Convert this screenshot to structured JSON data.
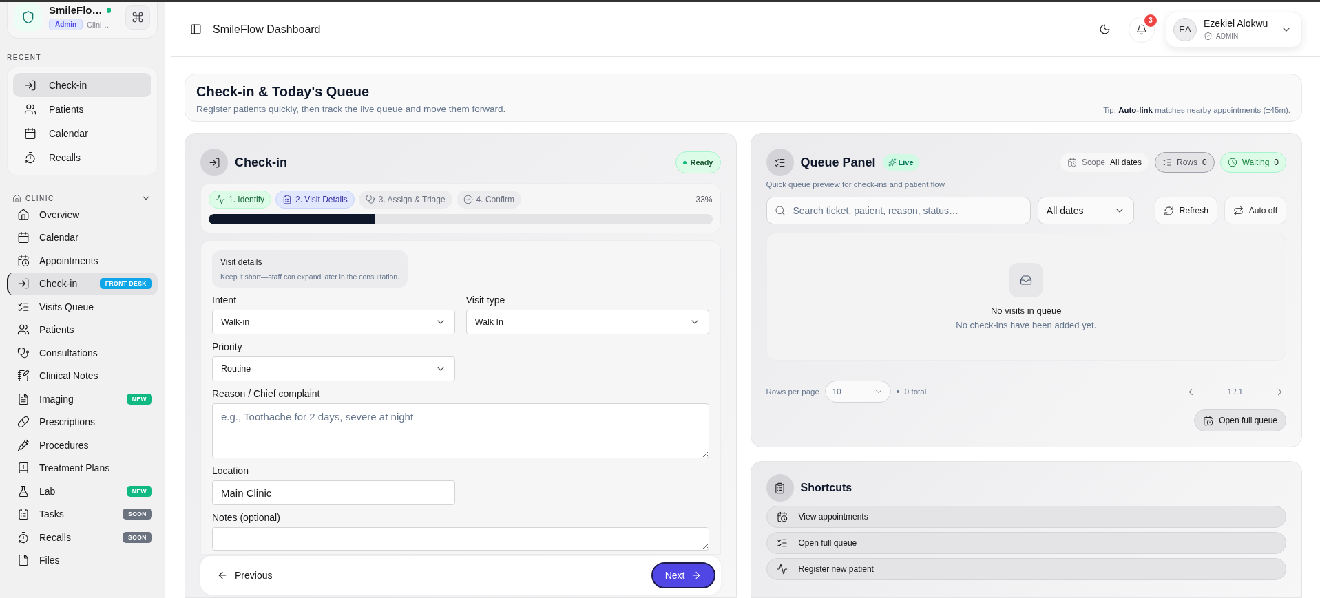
{
  "sidebar": {
    "brand": {
      "name": "SmileFlo…",
      "online": true,
      "role": "Admin",
      "subtitle": "Clini…"
    },
    "recent_title": "RECENT",
    "recent": [
      {
        "label": "Check-in",
        "selected": true
      },
      {
        "label": "Patients",
        "selected": false
      },
      {
        "label": "Calendar",
        "selected": false
      },
      {
        "label": "Recalls",
        "selected": false
      }
    ],
    "group": {
      "title": "CLINIC",
      "expanded": true
    },
    "items": [
      {
        "label": "Overview",
        "selected": false
      },
      {
        "label": "Calendar",
        "selected": false
      },
      {
        "label": "Appointments",
        "selected": false
      },
      {
        "label": "Check-in",
        "selected": true,
        "badge": {
          "text": "FRONT DESK",
          "color": "#0ea5e9"
        }
      },
      {
        "label": "Visits Queue",
        "selected": false
      },
      {
        "label": "Patients",
        "selected": false
      },
      {
        "label": "Consultations",
        "selected": false
      },
      {
        "label": "Clinical Notes",
        "selected": false
      },
      {
        "label": "Imaging",
        "selected": false,
        "badge": {
          "text": "NEW",
          "color": "#10b981"
        }
      },
      {
        "label": "Prescriptions",
        "selected": false
      },
      {
        "label": "Procedures",
        "selected": false
      },
      {
        "label": "Treatment Plans",
        "selected": false
      },
      {
        "label": "Lab",
        "selected": false,
        "badge": {
          "text": "NEW",
          "color": "#10b981"
        }
      },
      {
        "label": "Tasks",
        "selected": false,
        "badge": {
          "text": "SOON",
          "color": "#6b7280"
        }
      },
      {
        "label": "Recalls",
        "selected": false,
        "badge": {
          "text": "SOON",
          "color": "#6b7280"
        }
      },
      {
        "label": "Files",
        "selected": false
      }
    ]
  },
  "header": {
    "title": "SmileFlow Dashboard",
    "notifications": "3",
    "user": {
      "initials": "EA",
      "name": "Ezekiel Alokwu",
      "role": "ADMIN"
    }
  },
  "intro": {
    "title": "Check-in & Today's Queue",
    "subtitle": "Register patients quickly, then track the live queue and move them forward.",
    "tip": "Tip: **Auto-link** matches nearby appointments (±45m)."
  },
  "checkin": {
    "title": "Check-in",
    "status": "Ready",
    "steps": [
      {
        "label": "1. Identify",
        "done": true,
        "selected": false
      },
      {
        "label": "2. Visit Details",
        "done": false,
        "selected": true
      },
      {
        "label": "3. Assign & Triage",
        "done": false,
        "selected": false
      },
      {
        "label": "4. Confirm",
        "done": false,
        "selected": false
      }
    ],
    "progress": {
      "level": 0.33,
      "reading": "33%"
    },
    "section": {
      "title": "Visit details",
      "hint": "Keep it short—staff can expand later in the consultation."
    },
    "fields": [
      {
        "kind": "select",
        "label": "Intent",
        "value": "Walk-in"
      },
      {
        "kind": "select",
        "label": "Visit type",
        "value": "Walk In"
      },
      {
        "kind": "select",
        "label": "Priority",
        "value": "Routine"
      },
      {
        "kind": "textarea",
        "label": "Reason / Chief complaint",
        "placeholder": "e.g., Toothache for 2 days, severe at night"
      },
      {
        "kind": "input",
        "label": "Location",
        "value": "Main Clinic"
      },
      {
        "kind": "textarea",
        "label": "Notes (optional)"
      }
    ],
    "previous": "Previous",
    "next": "Next"
  },
  "queue": {
    "title": "Queue Panel",
    "live": "Live",
    "subtitle": "Quick queue preview for check-ins and patient flow",
    "scope": {
      "label": "Scope",
      "value": "All dates"
    },
    "rows": {
      "label": "Rows",
      "value": "0"
    },
    "waiting": {
      "label": "Waiting",
      "value": "0"
    },
    "search_placeholder": "Search ticket, patient, reason, status…",
    "date_filter": "All dates",
    "refresh": "Refresh",
    "auto": "Auto off",
    "empty": {
      "title": "No visits in queue",
      "text": "No check-ins have been added yet."
    },
    "pagination": {
      "rows_label": "Rows per page",
      "page_size": "10",
      "total": "0 total",
      "page": "1 / 1"
    },
    "open_button": "Open full queue"
  },
  "shortcuts": {
    "title": "Shortcuts",
    "items": [
      "View appointments",
      "Open full queue",
      "Register new patient"
    ]
  }
}
